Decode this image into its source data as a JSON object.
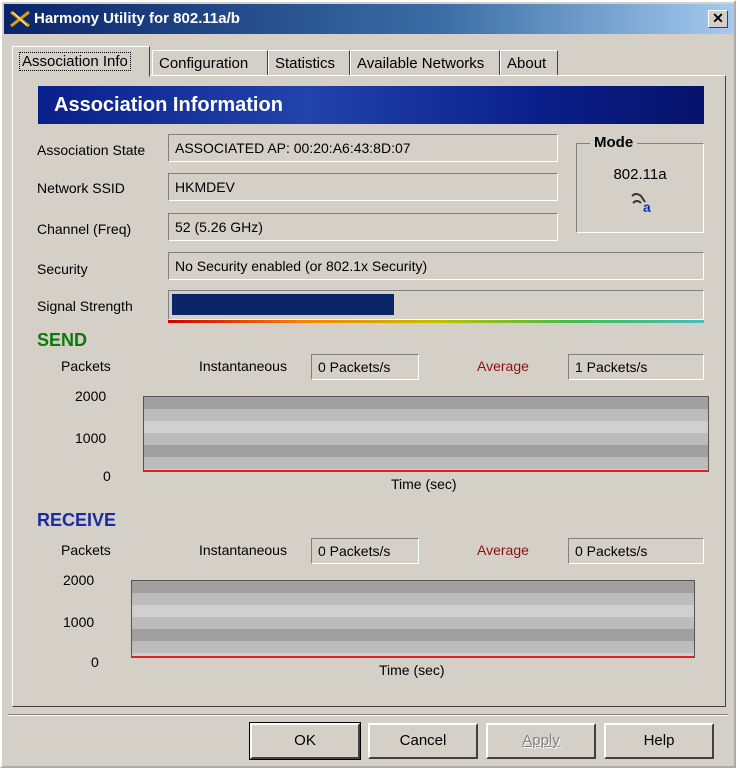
{
  "window": {
    "title": "Harmony Utility for 802.11a/b"
  },
  "tabs": [
    {
      "label": "Association Info",
      "active": true
    },
    {
      "label": "Configuration"
    },
    {
      "label": "Statistics"
    },
    {
      "label": "Available Networks"
    },
    {
      "label": "About"
    }
  ],
  "banner": {
    "title": "Association Information"
  },
  "fields": {
    "association_state": {
      "label": "Association State",
      "value": "ASSOCIATED AP:  00:20:A6:43:8D:07"
    },
    "network_ssid": {
      "label": "Network SSID",
      "value": "HKMDEV"
    },
    "channel": {
      "label": "Channel  (Freq)",
      "value": "52  (5.26 GHz)"
    },
    "security": {
      "label": "Security",
      "value": "No Security enabled (or 802.1x Security)"
    },
    "signal": {
      "label": "Signal Strength",
      "level": 0.42
    }
  },
  "mode": {
    "title": "Mode",
    "value": "802.11a",
    "icon": "wireless-a-icon"
  },
  "send": {
    "title": "SEND",
    "packets_label": "Packets",
    "inst_label": "Instantaneous",
    "inst_value": "0  Packets/s",
    "avg_label": "Average",
    "avg_value": "1  Packets/s",
    "y_ticks": [
      "2000",
      "1000",
      "0"
    ],
    "x_label": "Time (sec)"
  },
  "receive": {
    "title": "RECEIVE",
    "packets_label": "Packets",
    "inst_label": "Instantaneous",
    "inst_value": "0  Packets/s",
    "avg_label": "Average",
    "avg_value": "0  Packets/s",
    "y_ticks": [
      "2000",
      "1000",
      "0"
    ],
    "x_label": "Time (sec)"
  },
  "buttons": {
    "ok": "OK",
    "cancel": "Cancel",
    "apply": "Apply",
    "help": "Help"
  },
  "colors": {
    "section_send": "#0a7a0a",
    "section_receive": "#1a2ca0",
    "average_label": "#8a1010",
    "signal_fill": "#0a2468"
  }
}
